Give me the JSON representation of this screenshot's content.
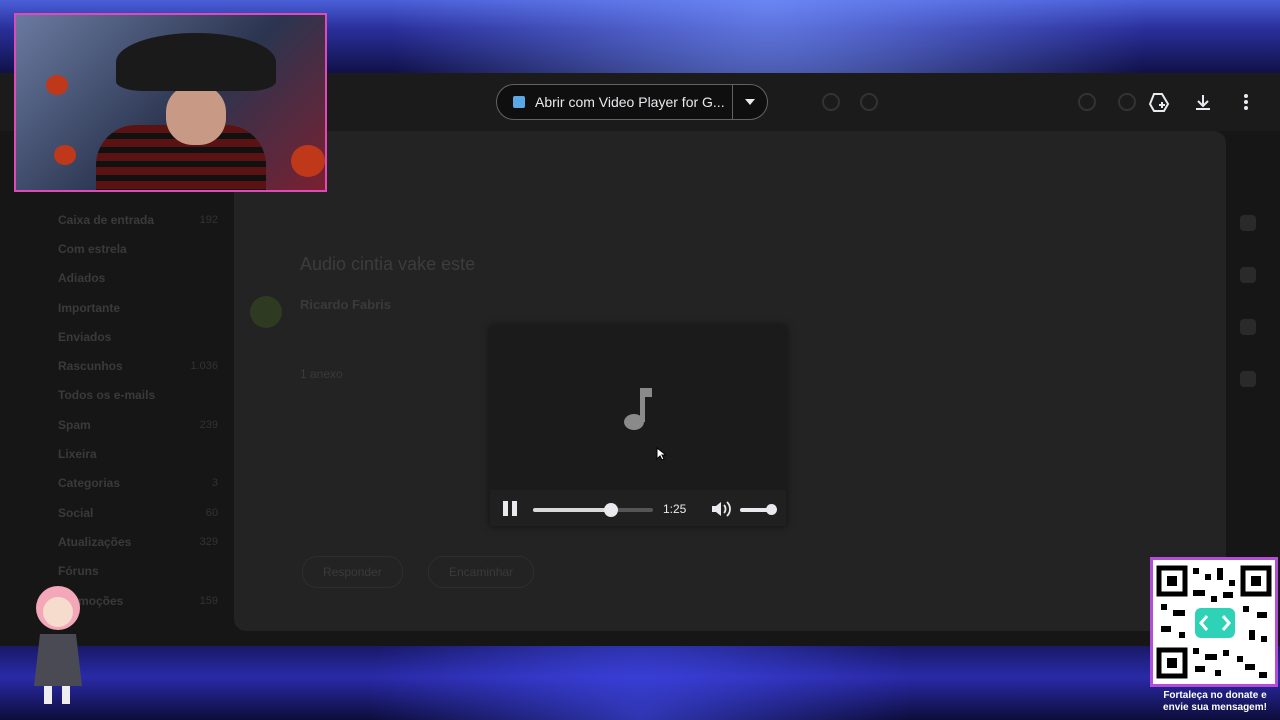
{
  "topbar": {
    "open_with_label": "Abrir com Video Player for G...",
    "icons": [
      "add-to-drive-icon",
      "download-icon",
      "more-vert-icon"
    ]
  },
  "email": {
    "subject": "Audio cintia vake este",
    "sender": "Ricardo Fabris",
    "attachment_text": "1 anexo",
    "reply_label": "Responder",
    "forward_label": "Encaminhar"
  },
  "sidebar": {
    "items": [
      {
        "label": "Caixa de entrada",
        "count": "192"
      },
      {
        "label": "Com estrela",
        "count": ""
      },
      {
        "label": "Adiados",
        "count": ""
      },
      {
        "label": "Importante",
        "count": ""
      },
      {
        "label": "Enviados",
        "count": ""
      },
      {
        "label": "Rascunhos",
        "count": "1.036"
      },
      {
        "label": "Todos os e-mails",
        "count": ""
      },
      {
        "label": "Spam",
        "count": "239"
      },
      {
        "label": "Lixeira",
        "count": ""
      },
      {
        "label": "Categorias",
        "count": "3"
      },
      {
        "label": "Social",
        "count": "60"
      },
      {
        "label": "Atualizações",
        "count": "329"
      },
      {
        "label": "Fóruns",
        "count": ""
      },
      {
        "label": "Promoções",
        "count": "159"
      }
    ]
  },
  "player": {
    "time": "1:25",
    "progress": 0.65,
    "volume": 0.85,
    "state": "playing",
    "icon": "music-note-icon"
  },
  "overlay": {
    "qr_caption": "Fortaleça no donate e envie sua mensagem!"
  }
}
